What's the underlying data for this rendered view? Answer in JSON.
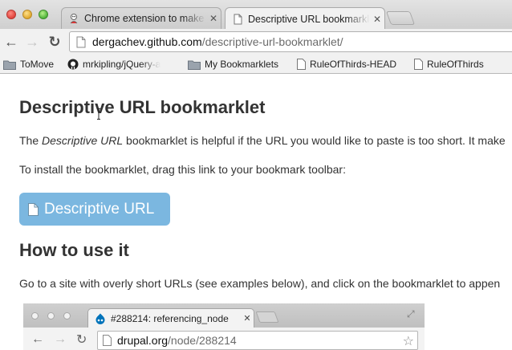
{
  "window": {
    "tabs": [
      {
        "title": "Chrome extension to make a",
        "favicon": "puzzle-piece-icon",
        "active": false
      },
      {
        "title": "Descriptive URL bookmarklet",
        "favicon": "page-icon",
        "active": true
      }
    ]
  },
  "toolbar": {
    "url_host": "dergachev.github.com",
    "url_path": "/descriptive-url-bookmarklet/"
  },
  "bookmarks": [
    {
      "label": "ToMove",
      "icon": "folder-icon"
    },
    {
      "label": "mrkipling/jQuery-a",
      "icon": "github-icon"
    },
    {
      "label": "My Bookmarklets",
      "icon": "folder-icon"
    },
    {
      "label": "RuleOfThirds-HEAD",
      "icon": "page-icon"
    },
    {
      "label": "RuleOfThirds",
      "icon": "page-icon"
    }
  ],
  "page": {
    "heading": "Descriptive URL bookmarklet",
    "intro_prefix": "The ",
    "intro_em": "Descriptive URL",
    "intro_suffix": " bookmarklet is helpful if the URL you would like to paste is too short. It make",
    "install_text": "To install the bookmarklet, drag this link to your bookmark toolbar:",
    "bookmarklet_label": "Descriptive URL",
    "howto_heading": "How to use it",
    "howto_text": "Go to a site with overly short URLs (see examples below), and click on the bookmarklet to appen"
  },
  "screenshot": {
    "tab_title": "#288214: referencing_node",
    "url_host": "drupal.org",
    "url_path": "/node/288214"
  },
  "colors": {
    "bookmarklet_bg": "#7bb7e0",
    "text": "#333333",
    "drupal_blue": "#0073ba"
  }
}
